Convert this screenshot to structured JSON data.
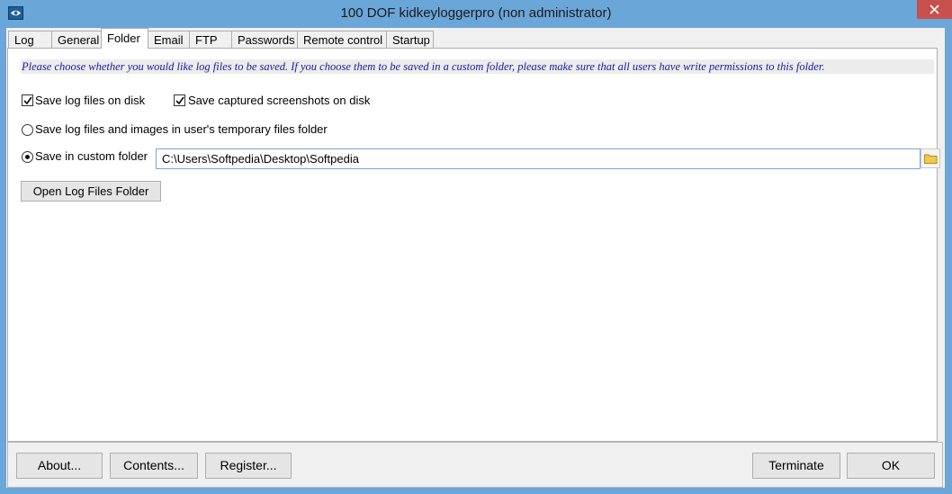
{
  "window": {
    "title": "100 DOF kidkeyloggerpro (non administrator)",
    "app_icon": "eye-icon",
    "close_icon": "close-icon",
    "close_color": "#c7504c",
    "frame_color": "#6aa6d8"
  },
  "tabs": [
    {
      "label": "Log",
      "active": false
    },
    {
      "label": "General",
      "active": false
    },
    {
      "label": "Folder",
      "active": true
    },
    {
      "label": "Email",
      "active": false
    },
    {
      "label": "FTP",
      "active": false
    },
    {
      "label": "Passwords",
      "active": false
    },
    {
      "label": "Remote control",
      "active": false
    },
    {
      "label": "Startup",
      "active": false
    }
  ],
  "folder": {
    "info_text": "Please choose whether you would like log files to be saved. If you choose them to be saved in a custom folder, please make sure that all users have write permissions to this folder.",
    "info_color": "#1a1a9c",
    "save_log_disk": {
      "label": "Save log files on disk",
      "checked": true
    },
    "save_screenshots_disk": {
      "label": "Save captured screenshots on disk",
      "checked": true
    },
    "temp_folder": {
      "label": "Save log files and images in user's temporary files folder",
      "selected": false
    },
    "custom_folder": {
      "label": "Save in custom folder",
      "selected": true
    },
    "custom_path": "C:\\Users\\Softpedia\\Desktop\\Softpedia",
    "browse_icon": "folder-icon",
    "open_folder_label": "Open Log Files Folder"
  },
  "footer": {
    "about_label": "About...",
    "contents_label": "Contents...",
    "register_label": "Register...",
    "terminate_label": "Terminate",
    "ok_label": "OK"
  }
}
